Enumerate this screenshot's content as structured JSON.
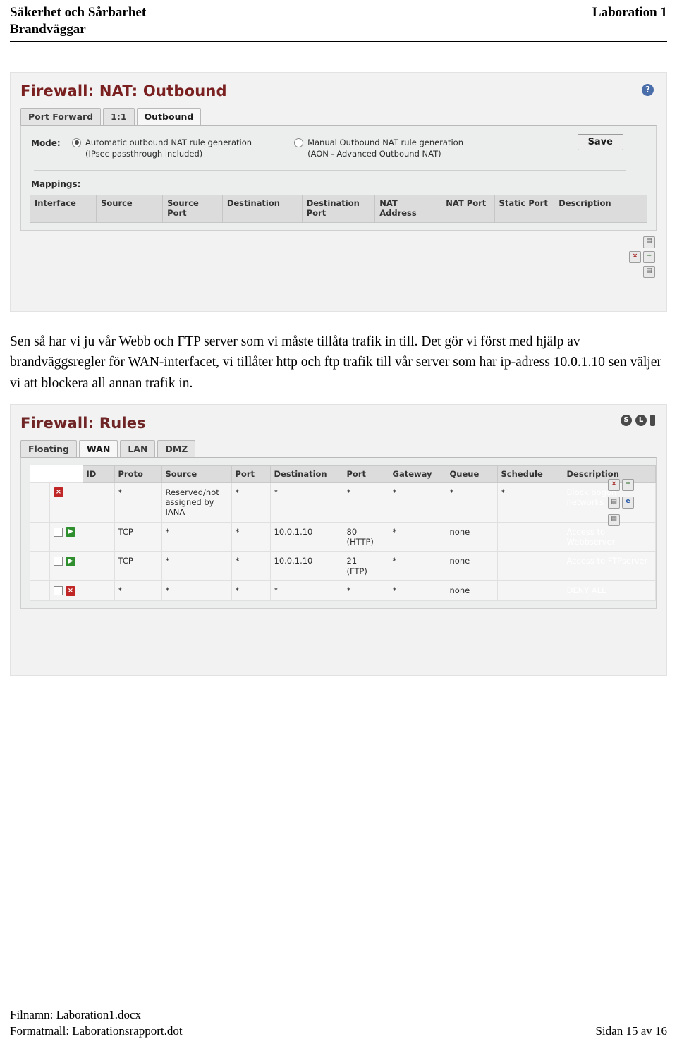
{
  "header": {
    "title_line1": "Säkerhet och Sårbarhet",
    "title_line2": "Brandväggar",
    "right": "Laboration 1"
  },
  "nat_screenshot": {
    "title": "Firewall: NAT: Outbound",
    "help_icon": "?",
    "tabs": [
      {
        "label": "Port Forward",
        "active": false
      },
      {
        "label": "1:1",
        "active": false
      },
      {
        "label": "Outbound",
        "active": true
      }
    ],
    "mode_label": "Mode:",
    "options": [
      {
        "line1": "Automatic outbound NAT rule generation",
        "line2": "(IPsec passthrough included)",
        "checked": true
      },
      {
        "line1": "Manual Outbound NAT rule generation",
        "line2": "(AON - Advanced Outbound NAT)",
        "checked": false
      }
    ],
    "save_label": "Save",
    "mappings_label": "Mappings:",
    "columns": [
      "Interface",
      "Source",
      "Source\nPort",
      "Destination",
      "Destination\nPort",
      "NAT\nAddress",
      "NAT\nPort",
      "Static\nPort",
      "Description"
    ],
    "rows": []
  },
  "paragraph": "Sen så har vi ju vår Webb och FTP server som vi måste tillåta trafik in till. Det gör vi först med hjälp av brandväggsregler för WAN-interfacet, vi tillåter http och ftp trafik till vår server som har ip-adress 10.0.1.10 sen väljer vi att blockera all annan trafik in.",
  "rules_screenshot": {
    "title": "Firewall: Rules",
    "status_icons": [
      "S",
      "L",
      "|"
    ],
    "tabs": [
      {
        "label": "Floating",
        "active": false
      },
      {
        "label": "WAN",
        "active": true
      },
      {
        "label": "LAN",
        "active": false
      },
      {
        "label": "DMZ",
        "active": false
      }
    ],
    "columns": [
      "ID",
      "Proto",
      "Source",
      "Port",
      "Destination",
      "Port",
      "Gateway",
      "Queue",
      "Schedule",
      "Description"
    ],
    "rows": [
      {
        "state": "block",
        "has_checkbox": false,
        "id": "",
        "proto": "*",
        "source": "Reserved/not assigned by IANA",
        "src_port": "*",
        "destination": "*",
        "dst_port": "*",
        "gateway": "*",
        "queue": "*",
        "schedule": "*",
        "description": "Block bogon networks"
      },
      {
        "state": "pass",
        "has_checkbox": true,
        "id": "",
        "proto": "TCP",
        "source": "*",
        "src_port": "*",
        "destination": "10.0.1.10",
        "dst_port": "80 (HTTP)",
        "gateway": "*",
        "queue": "none",
        "schedule": "",
        "description": "Access to Webbserver"
      },
      {
        "state": "pass",
        "has_checkbox": true,
        "id": "",
        "proto": "TCP",
        "source": "*",
        "src_port": "*",
        "destination": "10.0.1.10",
        "dst_port": "21 (FTP)",
        "gateway": "*",
        "queue": "none",
        "schedule": "",
        "description": "Access to FTPserver"
      },
      {
        "state": "block",
        "has_checkbox": true,
        "id": "",
        "proto": "*",
        "source": "*",
        "src_port": "*",
        "destination": "*",
        "dst_port": "*",
        "gateway": "*",
        "queue": "none",
        "schedule": "",
        "description": "DENY ALL"
      }
    ]
  },
  "footer": {
    "filename_label": "Filnamn: Laboration1.docx",
    "template_label": "Formatmall: Laborationsrapport.dot",
    "page_label": "Sidan 15 av 16"
  }
}
